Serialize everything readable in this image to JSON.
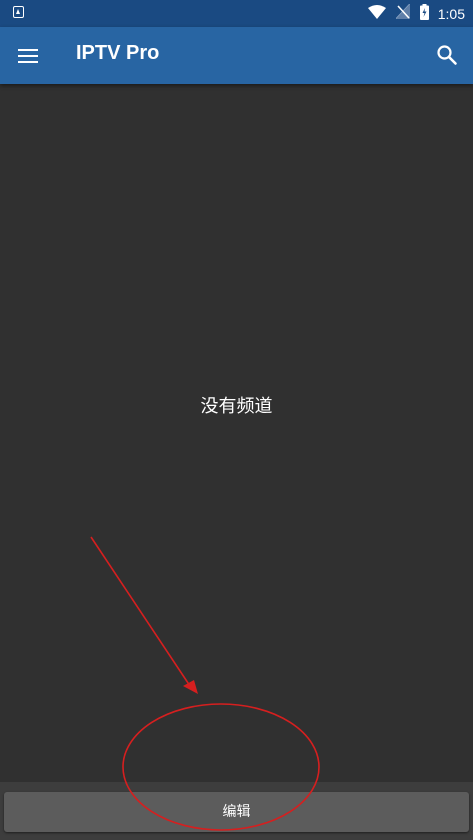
{
  "status_bar": {
    "time": "1:05",
    "icons": [
      "accessibility-icon",
      "wifi-icon",
      "no-signal-icon",
      "battery-charging-icon"
    ]
  },
  "app_bar": {
    "title": "IPTV Pro",
    "menu_icon": "hamburger-menu-icon",
    "search_icon": "search-icon"
  },
  "content": {
    "empty_message": "没有频道"
  },
  "bottom_bar": {
    "edit_label": "编辑"
  },
  "colors": {
    "status_bar": "#1a4a82",
    "app_bar": "#2865a3",
    "background": "#303030",
    "button": "#5c5c5c",
    "annotation": "#d61f1f"
  }
}
